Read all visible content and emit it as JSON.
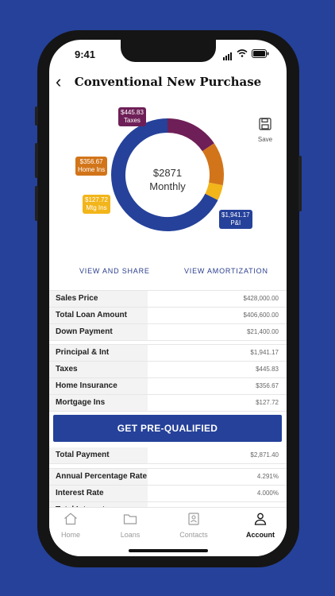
{
  "status": {
    "time": "9:41"
  },
  "header": {
    "title": "Conventional New Purchase"
  },
  "save": {
    "label": "Save"
  },
  "chart": {
    "center_amount": "$2871",
    "center_label": "Monthly"
  },
  "chart_data": {
    "type": "pie",
    "categories": [
      "Taxes",
      "Home Ins",
      "Mtg Ins",
      "P&I"
    ],
    "values": [
      445.83,
      356.67,
      127.72,
      1941.17
    ],
    "colors": [
      "#6e1f57",
      "#d2751a",
      "#f2b51a",
      "#25419a"
    ]
  },
  "labels": {
    "taxes": {
      "amount": "$445.83",
      "name": "Taxes"
    },
    "home_ins": {
      "amount": "$356.67",
      "name": "Home Ins"
    },
    "mtg_ins": {
      "amount": "$127.72",
      "name": "Mtg Ins"
    },
    "pi": {
      "amount": "$1,941.17",
      "name": "P&I"
    }
  },
  "links": {
    "view_share": "VIEW AND SHARE",
    "view_amort": "VIEW AMORTIZATION"
  },
  "table1": [
    {
      "label": "Sales Price",
      "value": "$428,000.00"
    },
    {
      "label": "Total Loan Amount",
      "value": "$406,600.00"
    },
    {
      "label": "Down Payment",
      "value": "$21,400.00"
    }
  ],
  "table2": [
    {
      "label": "Principal & Int",
      "value": "$1,941.17"
    },
    {
      "label": "Taxes",
      "value": "$445.83"
    },
    {
      "label": "Home Insurance",
      "value": "$356.67"
    },
    {
      "label": "Mortgage Ins",
      "value": "$127.72"
    }
  ],
  "cta": {
    "label": "GET PRE-QUALIFIED"
  },
  "table3": [
    {
      "label": "Total Payment",
      "value": "$2,871.40"
    }
  ],
  "table4": [
    {
      "label": "Annual Percentage Rate",
      "value": "4.291%"
    },
    {
      "label": "Interest Rate",
      "value": "4.000%"
    },
    {
      "label": "Total Interest",
      "value": ""
    }
  ],
  "tabs": [
    {
      "label": "Home"
    },
    {
      "label": "Loans"
    },
    {
      "label": "Contacts"
    },
    {
      "label": "Account"
    }
  ]
}
